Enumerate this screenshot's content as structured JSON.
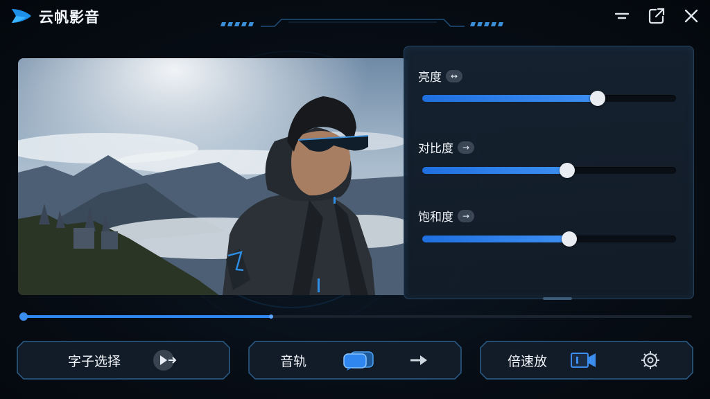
{
  "app": {
    "title": "云帆影音",
    "logo_icon": "play-logo-icon"
  },
  "window_controls": {
    "minimize_icon": "minimize-icon",
    "popout_icon": "popout-icon",
    "close_icon": "close-icon"
  },
  "adjust_panel": {
    "items": [
      {
        "label": "亮度",
        "badge": "↔",
        "badge_icon": "swap-icon",
        "value_percent": 69
      },
      {
        "label": "对比度",
        "badge": "→",
        "badge_icon": "arrow-right-icon",
        "value_percent": 57
      },
      {
        "label": "饱和度",
        "badge": "→",
        "badge_icon": "arrow-right-icon",
        "value_percent": 58
      }
    ]
  },
  "playback": {
    "progress_percent": 37
  },
  "bottom_buttons": [
    {
      "label": "字子选择",
      "icon": "play-forward-icon"
    },
    {
      "label": "音轨",
      "icon": "chat-bubbles-icon",
      "extra_icon": "arrow-right-icon"
    },
    {
      "label": "倍速放",
      "icon": "video-camera-icon",
      "extra_icon": "settings-gear-icon"
    }
  ],
  "colors": {
    "accent": "#2f86ee",
    "panel_border": "#25425a",
    "background": "#070d15"
  }
}
